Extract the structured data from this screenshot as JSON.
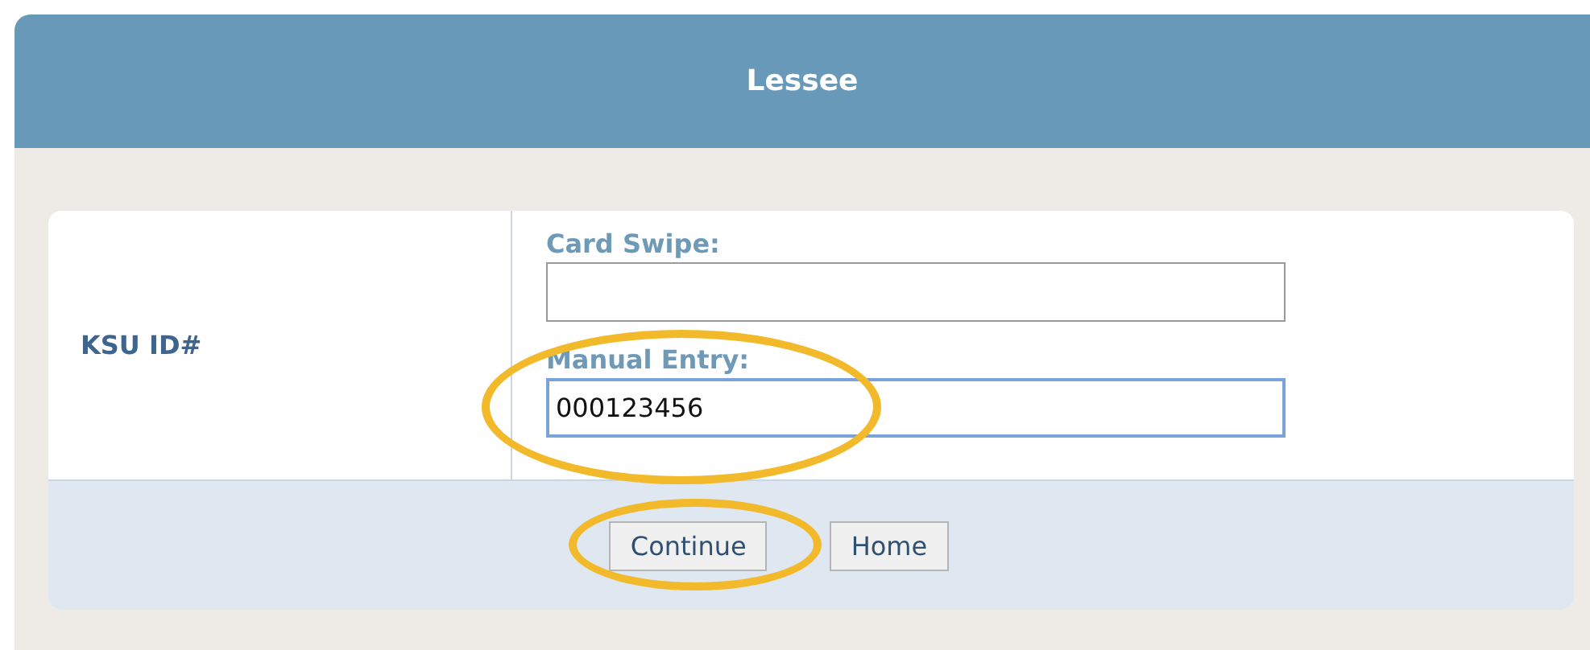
{
  "header": {
    "title": "Lessee"
  },
  "form": {
    "label": "KSU ID#",
    "fields": [
      {
        "label": "Card Swipe:",
        "focused": false,
        "highlighted": false
      },
      {
        "label": "Manual Entry:",
        "value": "000123456",
        "focused": true,
        "highlighted": true
      }
    ]
  },
  "buttons": [
    {
      "label": "Continue",
      "highlighted": true
    },
    {
      "label": "Home",
      "highlighted": false
    }
  ]
}
